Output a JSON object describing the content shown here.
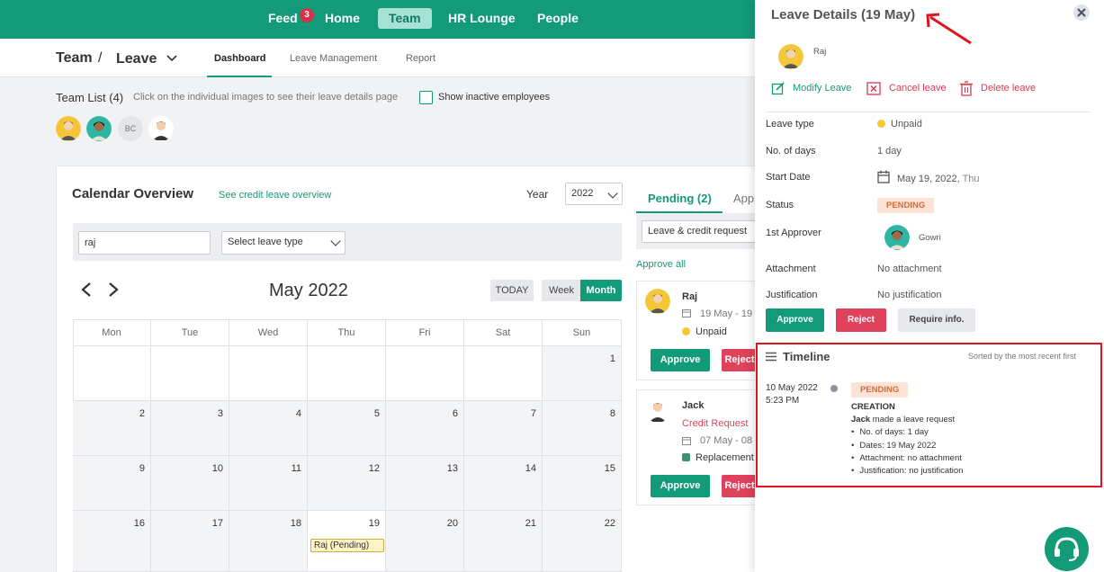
{
  "nav": {
    "items": [
      {
        "label": "Feed",
        "badge": "3"
      },
      {
        "label": "Home"
      },
      {
        "label": "Team",
        "active": true
      },
      {
        "label": "HR Lounge"
      },
      {
        "label": "People"
      }
    ],
    "accent_color": "#139a79"
  },
  "breadcrumb": {
    "root": "Team",
    "sep": "/",
    "current": "Leave"
  },
  "subtabs": [
    "Dashboard",
    "Leave Management",
    "Report"
  ],
  "team_list": {
    "title": "Team List (4)",
    "hint": "Click on the individual images to see their leave details page",
    "show_inactive_label": "Show inactive employees",
    "initials_avatar": "BC"
  },
  "calendar": {
    "title": "Calendar Overview",
    "credit_link": "See credit leave overview",
    "year_label": "Year",
    "year_value": "2022",
    "search_value": "raj",
    "leave_type_placeholder": "Select leave type",
    "month_title": "May 2022",
    "today_btn": "TODAY",
    "week_btn": "Week",
    "month_btn": "Month",
    "weekdays": [
      "Mon",
      "Tue",
      "Wed",
      "Thu",
      "Fri",
      "Sat",
      "Sun"
    ],
    "rows": [
      [
        "",
        "",
        "",
        "",
        "",
        "",
        "1"
      ],
      [
        "2",
        "3",
        "4",
        "5",
        "6",
        "7",
        "8"
      ],
      [
        "9",
        "10",
        "11",
        "12",
        "13",
        "14",
        "15"
      ],
      [
        "16",
        "17",
        "18",
        "19",
        "20",
        "21",
        "22"
      ]
    ],
    "event_label": "Raj (Pending)"
  },
  "pending": {
    "tab_pending": "Pending (2)",
    "tab_approved": "App",
    "filter_value": "Leave & credit request",
    "approve_all": "Approve all",
    "requests": [
      {
        "name": "Raj",
        "dates": "19 May - 19",
        "type": "Unpaid",
        "type_color": "#f5c637"
      },
      {
        "name": "Jack",
        "subtitle": "Credit Request",
        "dates": "07 May - 08",
        "type": "Replacement",
        "type_color": "#3f8f6f"
      }
    ],
    "approve_label": "Approve",
    "reject_label": "Reject"
  },
  "panel": {
    "title": "Leave Details (19 May)",
    "employee": "Raj",
    "modify": "Modify Leave",
    "cancel": "Cancel leave",
    "delete": "Delete leave",
    "fields": {
      "leave_type_label": "Leave type",
      "leave_type_value": "Unpaid",
      "days_label": "No. of days",
      "days_value": "1 day",
      "start_label": "Start Date",
      "start_value": "May 19, 2022,",
      "start_day": "Thu",
      "status_label": "Status",
      "status_value": "PENDING",
      "approver_label": "1st Approver",
      "approver_value": "Gowri",
      "attachment_label": "Attachment",
      "attachment_value": "No attachment",
      "justification_label": "Justification",
      "justification_value": "No justification"
    },
    "buttons": {
      "approve": "Approve",
      "reject": "Reject",
      "require": "Require info."
    },
    "timeline": {
      "title": "Timeline",
      "sorted": "Sorted by the most recent first",
      "date": "10 May 2022",
      "time": "5:23 PM",
      "status": "PENDING",
      "event": "CREATION",
      "actor": "Jack",
      "action": " made a leave request",
      "bullets": [
        "No. of days: 1 day",
        "Dates: 19 May 2022",
        "Attachment: no attachment",
        "Justification: no justification"
      ]
    }
  }
}
